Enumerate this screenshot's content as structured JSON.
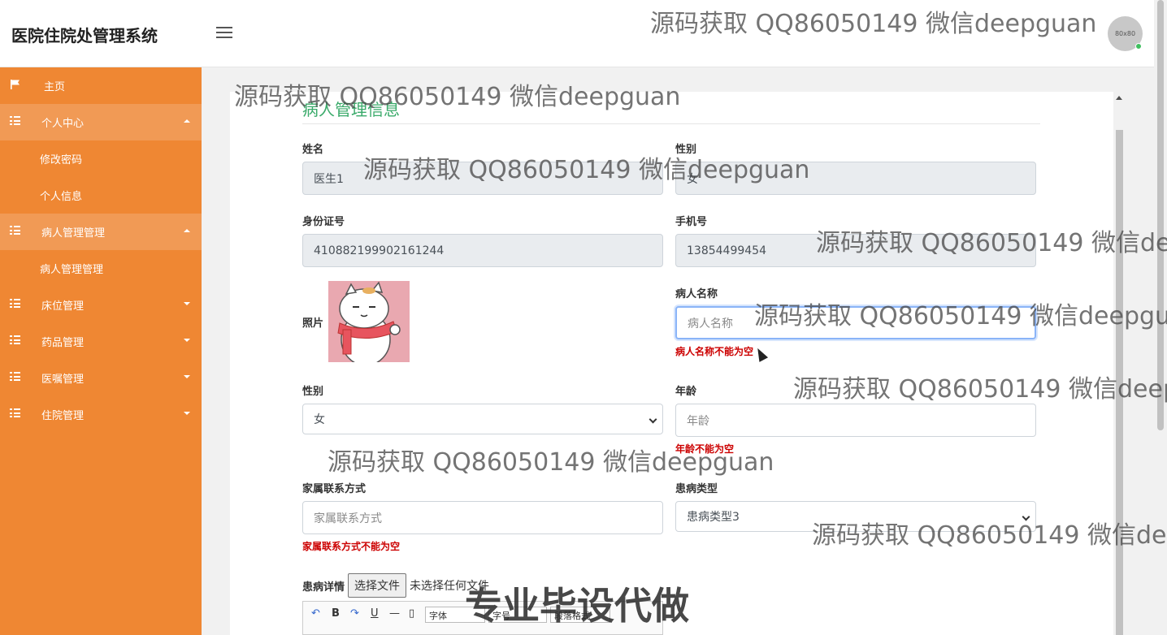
{
  "header": {
    "app_title": "医院住院处管理系统",
    "avatar_text": "80x80"
  },
  "sidebar": {
    "items": [
      {
        "label": "主页"
      },
      {
        "label": "个人中心",
        "sub": [
          "修改密码",
          "个人信息"
        ]
      },
      {
        "label": "病人管理管理",
        "sub": [
          "病人管理管理"
        ]
      },
      {
        "label": "床位管理"
      },
      {
        "label": "药品管理"
      },
      {
        "label": "医嘱管理"
      },
      {
        "label": "住院管理"
      }
    ]
  },
  "form": {
    "title": "病人管理信息",
    "name_label": "姓名",
    "name_value": "医生1",
    "gender_label": "性别",
    "gender_value": "女",
    "id_label": "身份证号",
    "id_value": "410882199902161244",
    "phone_label": "手机号",
    "phone_value": "13854499454",
    "photo_label": "照片",
    "patient_name_label": "病人名称",
    "patient_name_placeholder": "病人名称",
    "patient_name_error": "病人名称不能为空",
    "patient_gender_label": "性别",
    "patient_gender_value": "女",
    "age_label": "年龄",
    "age_placeholder": "年龄",
    "age_error": "年龄不能为空",
    "family_label": "家属联系方式",
    "family_placeholder": "家属联系方式",
    "family_error": "家属联系方式不能为空",
    "disease_type_label": "患病类型",
    "disease_type_value": "患病类型3",
    "detail_label": "患病详情",
    "file_button": "选择文件",
    "file_status": "未选择任何文件",
    "editor_font": "字体",
    "editor_size": "字号",
    "editor_para": "段落格式"
  },
  "watermarks": [
    "源码获取 QQ86050149 微信deepguan",
    "源码获取 QQ86050149 微信deepguan",
    "源码获取 QQ86050149 微信deepguan",
    "源码获取 QQ86050149 微信dee",
    "源码获取 QQ86050149 微信deepgua",
    "源码获取 QQ86050149 微信deep",
    "源码获取 QQ86050149 微信deepguan",
    "源码获取 QQ86050149 微信dee"
  ],
  "watermark_big": "专业毕设代做",
  "icons": [
    "menu-icon",
    "flag-icon",
    "grid-icon",
    "chevron-up-icon",
    "chevron-down-icon",
    "undo-icon",
    "redo-icon",
    "bold-icon",
    "underline-icon"
  ],
  "colors": {
    "sidebar": "#ef8733",
    "sidebar_open": "#f19a55",
    "title_green": "#3aaa6a",
    "error_red": "#cc0000"
  }
}
